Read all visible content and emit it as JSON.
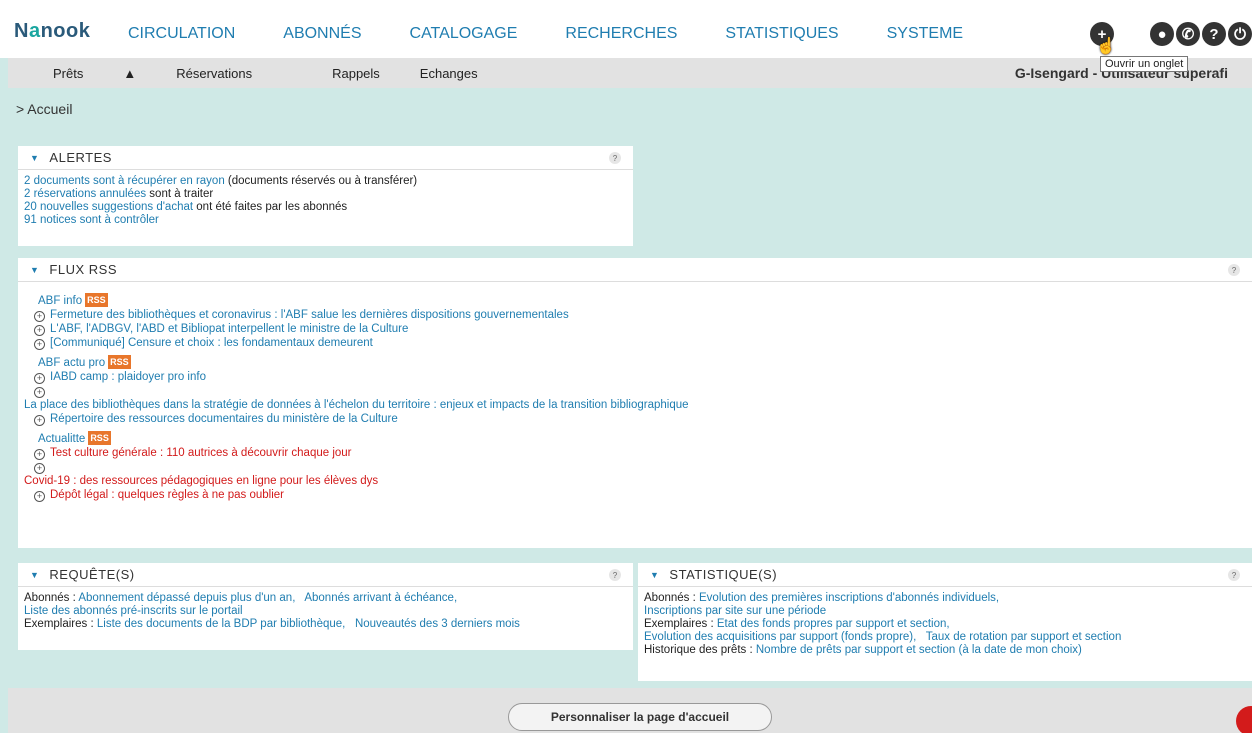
{
  "app": {
    "logo_main": "N",
    "logo_o": "a",
    "logo_rest": "nook"
  },
  "nav": [
    "CIRCULATION",
    "ABONNÉS",
    "CATALOGAGE",
    "RECHERCHES",
    "STATISTIQUES",
    "SYSTEME"
  ],
  "tooltip": "Ouvrir un onglet",
  "subnav": {
    "items": [
      "Prêts",
      "Réservations",
      "Rappels",
      "Echanges"
    ],
    "user": "G-Isengard - Utilisateur superafi"
  },
  "breadcrumb": "> Accueil",
  "alertes": {
    "title": "ALERTES",
    "l1_link": "2 documents sont à récupérer en rayon",
    "l1_text": " (documents réservés ou à transférer)",
    "l2_link": "2 réservations annulées",
    "l2_text": " sont à traiter",
    "l3_link": "20 nouvelles suggestions d'achat",
    "l3_text": " ont été faites par les abonnés",
    "l4_link": "91 notices sont à contrôler"
  },
  "rss": {
    "title": "FLUX RSS",
    "badge": "RSS",
    "feed1": "ABF info",
    "feed1_items": [
      "Fermeture des bibliothèques et coronavirus : l'ABF salue les dernières dispositions gouvernementales",
      "L'ABF, l'ADBGV, l'ABD et Bibliopat interpellent le ministre de la Culture",
      "[Communiqué] Censure et choix : les fondamentaux demeurent"
    ],
    "feed2": "ABF actu pro",
    "feed2_items": [
      "IABD camp : plaidoyer pro info",
      "La place des bibliothèques dans la stratégie de données à l'échelon du territoire : enjeux et impacts de la transition bibliographique",
      "Répertoire des ressources documentaires du ministère de la Culture"
    ],
    "feed3": "Actualitte",
    "feed3_items": [
      "Test culture générale : 110 autrices à découvrir chaque jour",
      "Covid-19 : des ressources pédagogiques en ligne pour les élèves dys",
      "Dépôt légal : quelques règles à ne pas oublier"
    ]
  },
  "requetes": {
    "title": "REQUÊTE(S)",
    "abonnes_label": "Abonnés :",
    "abonnes_1": "Abonnement dépassé depuis plus d'un an,",
    "abonnes_2": "Abonnés arrivant à échéance,",
    "abonnes_3": "Liste des abonnés pré-inscrits sur le portail",
    "exemplaires_label": "Exemplaires :",
    "exemplaires_1": "Liste des documents de la BDP par bibliothèque,",
    "exemplaires_2": "Nouveautés des 3 derniers mois"
  },
  "stats": {
    "title": "STATISTIQUE(S)",
    "abonnes_label": "Abonnés :",
    "abonnes_1": "Evolution des premières inscriptions d'abonnés individuels,",
    "abonnes_2": "Inscriptions par site sur une période",
    "exemplaires_label": "Exemplaires :",
    "exemplaires_1": "Etat des fonds propres par support et section,",
    "exemplaires_2": "Evolution des acquisitions par support (fonds propre),",
    "exemplaires_3": "Taux de rotation par support et section",
    "histo_label": "Historique des prêts :",
    "histo_1": "Nombre de prêts par support et section (à la date de mon choix)"
  },
  "footer": {
    "customize": "Personnaliser la page d'accueil"
  },
  "icons": {
    "help": "?",
    "plus": "+"
  }
}
